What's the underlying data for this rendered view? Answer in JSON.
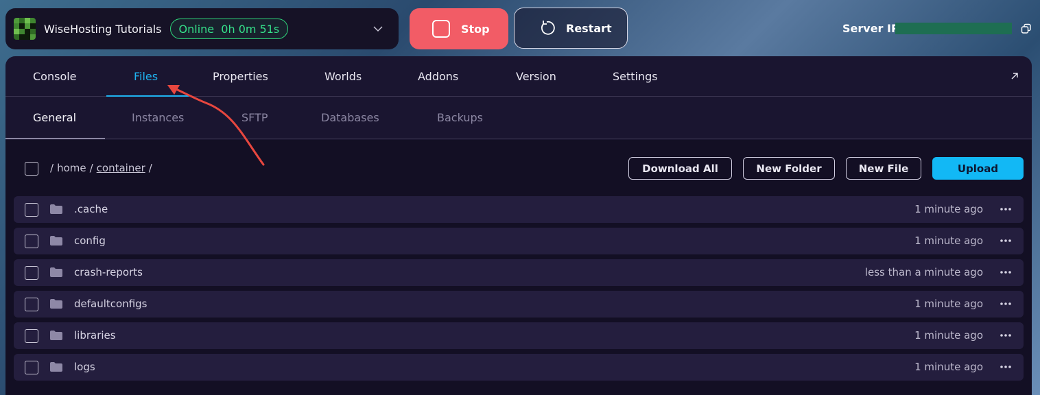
{
  "server": {
    "name": "WiseHosting Tutorials",
    "status": "Online",
    "uptime": "0h 0m 51s"
  },
  "actions": {
    "stop_label": "Stop",
    "restart_label": "Restart",
    "server_ip_label": "Server IP"
  },
  "main_tabs": [
    {
      "label": "Console"
    },
    {
      "label": "Files"
    },
    {
      "label": "Properties"
    },
    {
      "label": "Worlds"
    },
    {
      "label": "Addons"
    },
    {
      "label": "Version"
    },
    {
      "label": "Settings"
    }
  ],
  "active_main_tab": "Files",
  "sub_tabs": [
    {
      "label": "General"
    },
    {
      "label": "Instances"
    },
    {
      "label": "SFTP"
    },
    {
      "label": "Databases"
    },
    {
      "label": "Backups"
    }
  ],
  "active_sub_tab": "General",
  "breadcrumb": {
    "sep1": "/",
    "home": "home",
    "sep2": "/",
    "container": "container",
    "sep3": "/"
  },
  "toolbar": {
    "download_all": "Download All",
    "new_folder": "New Folder",
    "new_file": "New File",
    "upload": "Upload"
  },
  "files": [
    {
      "name": ".cache",
      "modified": "1 minute ago"
    },
    {
      "name": "config",
      "modified": "1 minute ago"
    },
    {
      "name": "crash-reports",
      "modified": "less than a minute ago"
    },
    {
      "name": "defaultconfigs",
      "modified": "1 minute ago"
    },
    {
      "name": "libraries",
      "modified": "1 minute ago"
    },
    {
      "name": "logs",
      "modified": "1 minute ago"
    }
  ],
  "colors": {
    "accent": "#1fb3f0",
    "online": "#35e08a",
    "stop": "#f25c66",
    "upload": "#12b8f5",
    "annotation_arrow": "#e8473f"
  }
}
